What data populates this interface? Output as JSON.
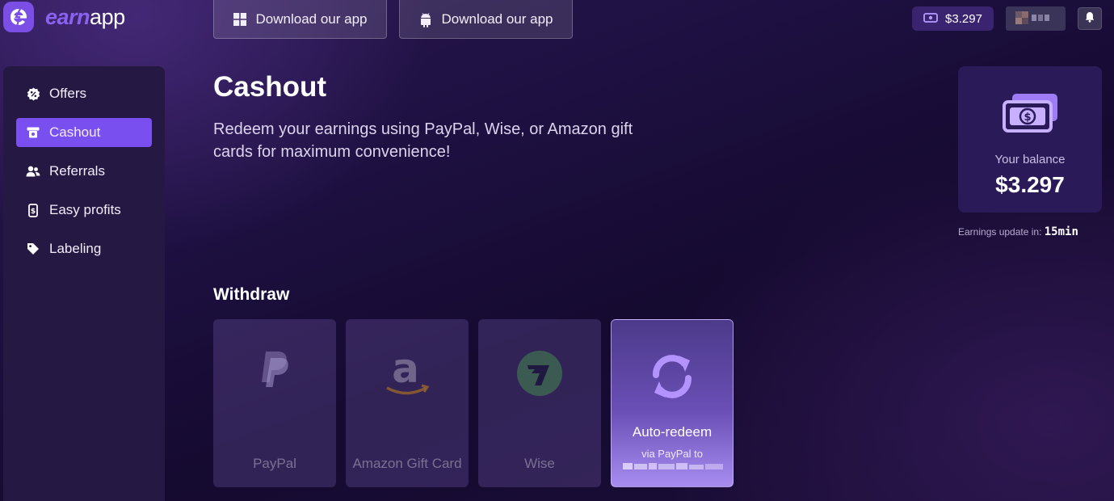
{
  "header": {
    "logo_earn": "earn",
    "logo_app": "app",
    "download_windows_label": "Download our app",
    "download_android_label": "Download our app",
    "balance_chip": "$3.297",
    "icons": {
      "logo": "earnapp-e-icon",
      "windows": "windows-icon",
      "android": "android-icon",
      "cash": "cash-icon",
      "bell": "bell-icon"
    }
  },
  "sidebar": {
    "items": [
      {
        "label": "Offers",
        "icon": "badge-percent-icon",
        "active": false
      },
      {
        "label": "Cashout",
        "icon": "cashout-icon",
        "active": true
      },
      {
        "label": "Referrals",
        "icon": "users-plus-icon",
        "active": false
      },
      {
        "label": "Easy profits",
        "icon": "phone-dollar-icon",
        "active": false
      },
      {
        "label": "Labeling",
        "icon": "tag-icon",
        "active": false
      }
    ]
  },
  "main": {
    "title": "Cashout",
    "description": "Redeem your earnings using PayPal, Wise, or Amazon gift cards for maximum convenience!",
    "withdraw_title": "Withdraw",
    "options": [
      {
        "label": "PayPal",
        "icon": "paypal-icon",
        "enabled": false
      },
      {
        "label": "Amazon Gift Card",
        "icon": "amazon-icon",
        "enabled": false
      },
      {
        "label": "Wise",
        "icon": "wise-icon",
        "enabled": false
      },
      {
        "label": "Auto-redeem",
        "sublabel": "via PayPal to",
        "icon": "refresh-icon",
        "enabled": true
      }
    ]
  },
  "balance": {
    "label": "Your balance",
    "value": "$3.297",
    "update_prefix": "Earnings update in:",
    "update_value": "15min"
  },
  "colors": {
    "accent": "#7a4ff0",
    "brand": "#8a62f0",
    "background": "#1a0f33",
    "sidebar": "#251842",
    "balance_card": "#2a1a58"
  }
}
